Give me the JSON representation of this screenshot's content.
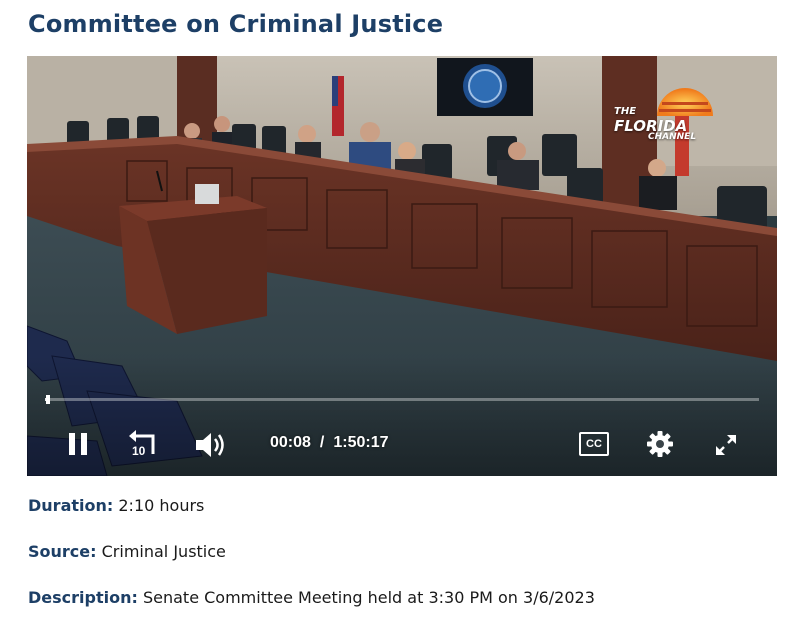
{
  "page": {
    "title": "Committee on Criminal Justice"
  },
  "player": {
    "current_time": "00:08",
    "separator": "/",
    "total_time": "1:50:17",
    "progress_fraction": 0.0012,
    "skip_back_seconds": "10",
    "cc_label": "CC",
    "logo": {
      "line1": "THE",
      "line2": "FLORIDA",
      "line3": "CHANNEL"
    },
    "icons": {
      "pause": "pause-icon",
      "skip_back": "rewind-10-icon",
      "volume": "volume-icon",
      "captions": "closed-captions-icon",
      "settings": "gear-icon",
      "fullscreen": "fullscreen-icon"
    }
  },
  "details": {
    "duration_label": "Duration:",
    "duration_value": "2:10 hours",
    "source_label": "Source:",
    "source_value": "Criminal Justice",
    "description_label": "Description:",
    "description_value": "Senate Committee Meeting held at 3:30 PM on 3/6/2023"
  },
  "colors": {
    "heading": "#1d3f66",
    "label": "#1d3f66"
  }
}
